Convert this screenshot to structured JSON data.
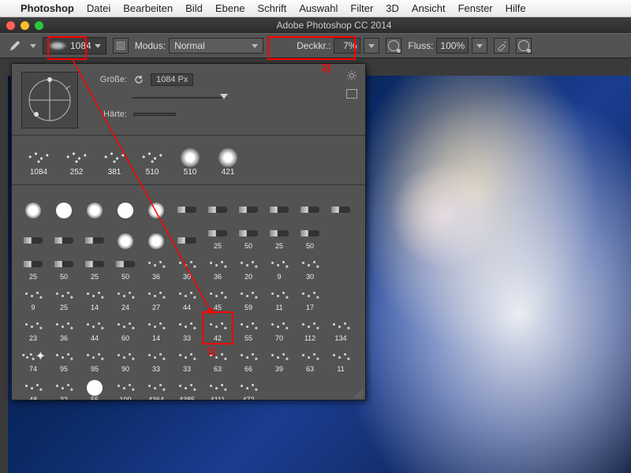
{
  "mac_menu": {
    "app": "Photoshop",
    "items": [
      "Datei",
      "Bearbeiten",
      "Bild",
      "Ebene",
      "Schrift",
      "Auswahl",
      "Filter",
      "3D",
      "Ansicht",
      "Fenster",
      "Hilfe"
    ]
  },
  "window": {
    "title": "Adobe Photoshop CC 2014"
  },
  "options": {
    "brush_size": "1084",
    "modus_label": "Modus:",
    "modus_value": "Normal",
    "deckkr_label": "Deckkr.:",
    "deckkr_value": "7%",
    "fluss_label": "Fluss:",
    "fluss_value": "100%"
  },
  "brush_panel": {
    "size_label": "Größe:",
    "size_value": "1084 Px",
    "hardness_label": "Härte:",
    "recent": [
      {
        "label": "1084",
        "kind": "scatter"
      },
      {
        "label": "252",
        "kind": "scatter"
      },
      {
        "label": "381",
        "kind": "scatter"
      },
      {
        "label": "510",
        "kind": "scatter"
      },
      {
        "label": "510",
        "kind": "roundsoft"
      },
      {
        "label": "421",
        "kind": "roundsoft"
      }
    ],
    "grid": [
      {
        "label": "",
        "k": "round"
      },
      {
        "label": "",
        "k": "hard"
      },
      {
        "label": "",
        "k": "round"
      },
      {
        "label": "",
        "k": "hard"
      },
      {
        "label": "",
        "k": "round"
      },
      {
        "label": "",
        "k": "tip"
      },
      {
        "label": "",
        "k": "tip"
      },
      {
        "label": "",
        "k": "tip"
      },
      {
        "label": "",
        "k": "tip"
      },
      {
        "label": "",
        "k": "tip"
      },
      {
        "label": "",
        "k": "tip"
      },
      {
        "label": "",
        "k": "tip"
      },
      {
        "label": "",
        "k": "tip"
      },
      {
        "label": "",
        "k": "tip"
      },
      {
        "label": "",
        "k": "round"
      },
      {
        "label": "",
        "k": "round"
      },
      {
        "label": "",
        "k": "tip"
      },
      {
        "label": "25",
        "k": "tip"
      },
      {
        "label": "50",
        "k": "tip"
      },
      {
        "label": "25",
        "k": "tip"
      },
      {
        "label": "50",
        "k": "tip"
      },
      {
        "label": "",
        "k": ""
      },
      {
        "label": "25",
        "k": "tip"
      },
      {
        "label": "50",
        "k": "tip"
      },
      {
        "label": "25",
        "k": "tip"
      },
      {
        "label": "50",
        "k": "tip"
      },
      {
        "label": "36",
        "k": "tex"
      },
      {
        "label": "30",
        "k": "tex"
      },
      {
        "label": "36",
        "k": "tex"
      },
      {
        "label": "20",
        "k": "tex"
      },
      {
        "label": "9",
        "k": "tex"
      },
      {
        "label": "30",
        "k": "tex"
      },
      {
        "label": "",
        "k": ""
      },
      {
        "label": "9",
        "k": "tex"
      },
      {
        "label": "25",
        "k": "tex"
      },
      {
        "label": "14",
        "k": "tex"
      },
      {
        "label": "24",
        "k": "tex"
      },
      {
        "label": "27",
        "k": "tex"
      },
      {
        "label": "44",
        "k": "tex"
      },
      {
        "label": "45",
        "k": "tex"
      },
      {
        "label": "59",
        "k": "tex"
      },
      {
        "label": "11",
        "k": "tex"
      },
      {
        "label": "17",
        "k": "tex"
      },
      {
        "label": "",
        "k": ""
      },
      {
        "label": "23",
        "k": "tex"
      },
      {
        "label": "36",
        "k": "tex"
      },
      {
        "label": "44",
        "k": "tex"
      },
      {
        "label": "60",
        "k": "tex"
      },
      {
        "label": "14",
        "k": "tex"
      },
      {
        "label": "33",
        "k": "tex"
      },
      {
        "label": "42",
        "k": "tex"
      },
      {
        "label": "55",
        "k": "tex"
      },
      {
        "label": "70",
        "k": "tex"
      },
      {
        "label": "112",
        "k": "tex"
      },
      {
        "label": "134",
        "k": "tex"
      },
      {
        "label": "74",
        "k": "star"
      },
      {
        "label": "95",
        "k": "tex"
      },
      {
        "label": "95",
        "k": "tex"
      },
      {
        "label": "90",
        "k": "tex"
      },
      {
        "label": "33",
        "k": "tex"
      },
      {
        "label": "33",
        "k": "tex"
      },
      {
        "label": "63",
        "k": "tex"
      },
      {
        "label": "66",
        "k": "tex"
      },
      {
        "label": "39",
        "k": "tex"
      },
      {
        "label": "63",
        "k": "tex"
      },
      {
        "label": "11",
        "k": "tex"
      },
      {
        "label": "48",
        "k": "tex"
      },
      {
        "label": "32",
        "k": "tex"
      },
      {
        "label": "55",
        "k": "hard"
      },
      {
        "label": "100",
        "k": "tex"
      },
      {
        "label": "4364",
        "k": "tex"
      },
      {
        "label": "4385",
        "k": "tex"
      },
      {
        "label": "4111",
        "k": "tex"
      },
      {
        "label": "472",
        "k": "tex"
      },
      {
        "label": "",
        "k": ""
      },
      {
        "label": "",
        "k": ""
      },
      {
        "label": "",
        "k": ""
      }
    ]
  },
  "annotations": {
    "marker1": "1)",
    "marker2": "2)"
  },
  "colors": {
    "highlight": "#ff0000"
  }
}
